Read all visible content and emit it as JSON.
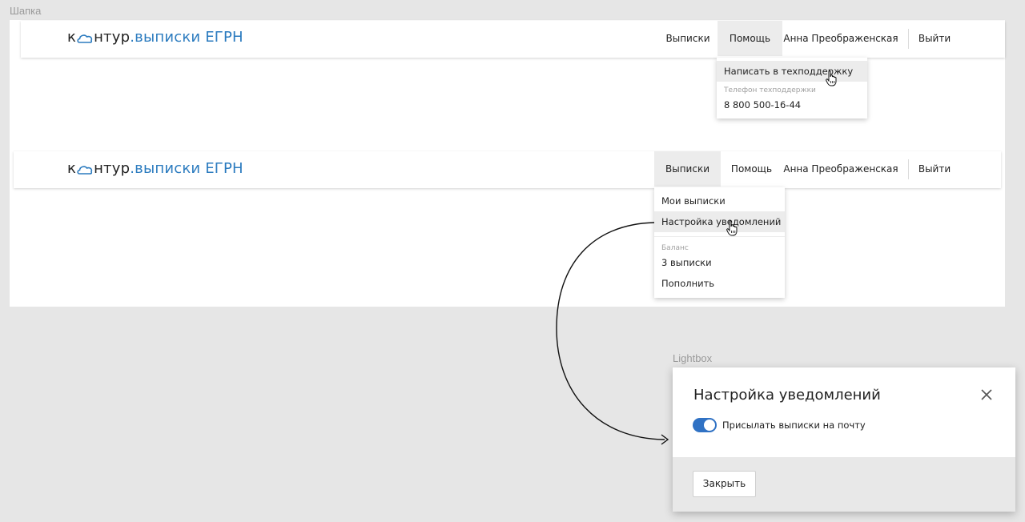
{
  "sections": {
    "header_label": "Шапка",
    "lightbox_label": "Lightbox"
  },
  "logo": {
    "prefix": "к",
    "suffix": "нтур",
    "dot": ".",
    "product": "выписки ЕГРН",
    "brand_color": "#2b7bbf"
  },
  "nav": {
    "statements": "Выписки",
    "help": "Помощь",
    "user": "Анна Преображенская",
    "logout": "Выйти"
  },
  "help_menu": {
    "write_support": "Написать в техподдержку",
    "phone_caption": "Телефон техподдержки",
    "phone": "8 800 500-16-44"
  },
  "statements_menu": {
    "my_statements": "Мои выписки",
    "notification_settings": "Настройка уведомлений",
    "balance_caption": "Баланс",
    "balance_value": "3 выписки",
    "top_up": "Пополнить"
  },
  "lightbox": {
    "title": "Настройка уведомлений",
    "toggle_label": "Присылать выписки на почту",
    "toggle_on": true,
    "close_button": "Закрыть",
    "accent_color": "#3072c4"
  },
  "icons": {
    "close": "close-icon",
    "cloud_logo": "cloud-icon",
    "hand_cursor": "hand-cursor-icon"
  }
}
